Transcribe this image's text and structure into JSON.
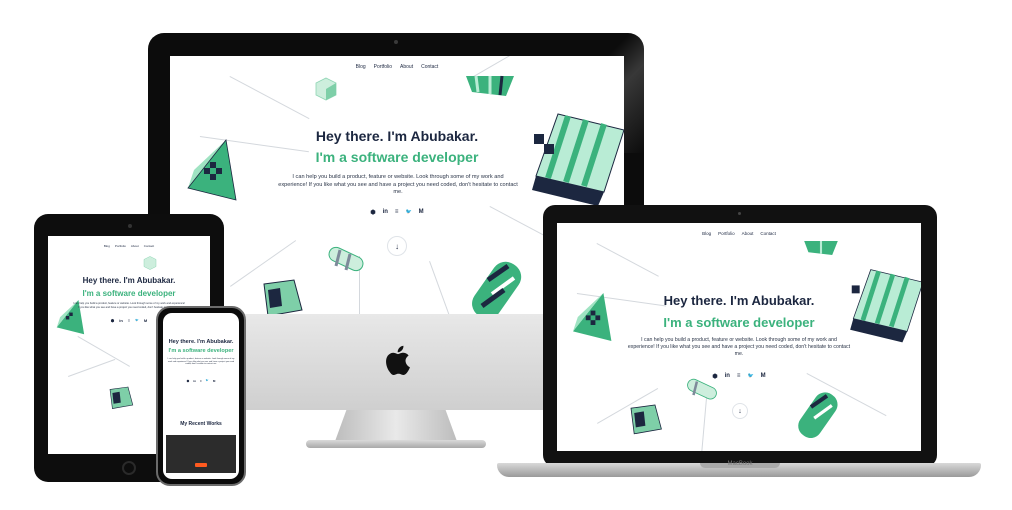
{
  "nav": {
    "items": [
      "Blog",
      "Portfolio",
      "About",
      "Contact"
    ]
  },
  "hero": {
    "title": "Hey there. I'm Abubakar.",
    "subtitle": "I'm a software developer",
    "text": "I can help you build a product, feature or website. Look through some of my work and experience! If you like what you see and have a project you need coded, don't hesitate to contact me."
  },
  "socials": [
    {
      "icon": "shield-icon",
      "glyph": "⬢"
    },
    {
      "icon": "linkedin-icon",
      "glyph": "in"
    },
    {
      "icon": "stackoverflow-icon",
      "glyph": "≡"
    },
    {
      "icon": "twitter-icon",
      "glyph": "🐦"
    },
    {
      "icon": "medium-icon",
      "glyph": "M"
    }
  ],
  "scroll": {
    "glyph": "↓"
  },
  "phone": {
    "works_title": "My Recent Works"
  },
  "macbook": {
    "brand": "MacBook"
  },
  "colors": {
    "accent": "#3bb27d",
    "navy": "#1c2740",
    "mint": "#b9ecd5"
  }
}
